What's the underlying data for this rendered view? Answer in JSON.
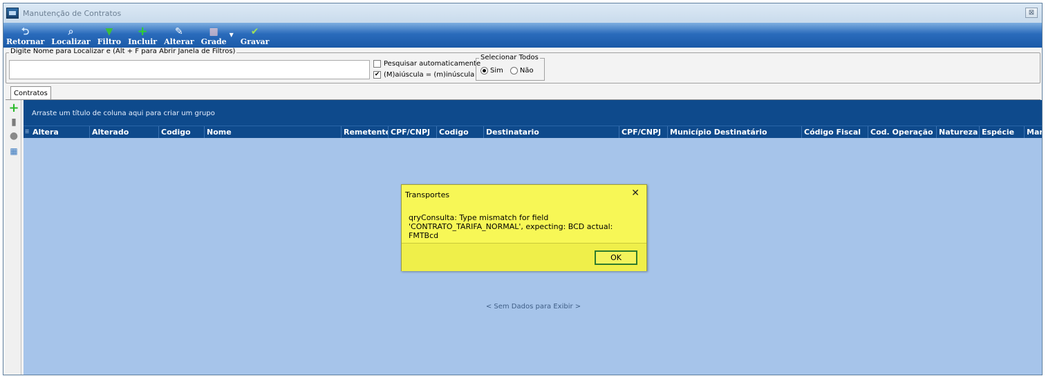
{
  "window": {
    "title": "Manutenção de Contratos",
    "close_glyph": "⊠"
  },
  "toolbar": {
    "buttons": [
      {
        "label": "Retornar",
        "icon": "undo-icon",
        "glyph": "⮌"
      },
      {
        "label": "Localizar",
        "icon": "search-icon",
        "glyph": "⌕"
      },
      {
        "label": "Filtro",
        "icon": "filter-icon",
        "glyph": "▼"
      },
      {
        "label": "Incluir",
        "icon": "plus-icon",
        "glyph": "+"
      },
      {
        "label": "Alterar",
        "icon": "edit-icon",
        "glyph": "✎"
      },
      {
        "label": "Grade",
        "icon": "grid-icon",
        "glyph": "▦"
      },
      {
        "label": "Gravar",
        "icon": "check-icon",
        "glyph": "✔"
      }
    ],
    "dropdown_glyph": "▼"
  },
  "search": {
    "legend": "Digite Nome para Localizar e (Alt + F para Abrir Janela de Filtros)",
    "value": "",
    "auto_search": {
      "label": "Pesquisar automaticamente",
      "checked_glyph": ""
    },
    "case_insensitive": {
      "label": "(M)aiúscula = (m)inúscula",
      "checked_glyph": "✔"
    },
    "select_all": {
      "legend": "Selecionar Todos",
      "yes": "Sim",
      "no": "Não"
    }
  },
  "tabs": [
    {
      "label": "Contratos"
    }
  ],
  "side_tools": {
    "add": "+",
    "delete": "▮",
    "info": "●",
    "grid": "▦"
  },
  "grid": {
    "group_panel_text": "Arraste um título de coluna aqui para criar um grupo",
    "indicator": "☰",
    "columns": [
      "Altera",
      "Alterado",
      "Codigo",
      "Nome",
      "Remetente",
      "CPF/CNPJ",
      "Codigo",
      "Destinatario",
      "CPF/CNPJ",
      "Município Destinatário",
      "Código Fiscal",
      "Cod. Operação",
      "Natureza",
      "Espécie",
      "Mar"
    ],
    "empty_text": "< Sem Dados para Exibir >"
  },
  "dialog": {
    "title": "Transportes",
    "close_glyph": "✕",
    "message_line1": "qryConsulta: Type mismatch for field",
    "message_line2": "'CONTRATO_TARIFA_NORMAL', expecting: BCD actual: FMTBcd",
    "ok_label": "OK"
  },
  "colors": {
    "toolbar_blue": "#2a6bbb",
    "grid_header": "#0e4a8c",
    "grid_body": "#a6c4ea",
    "dialog_bg": "#f7f756",
    "ok_border": "#2d7a2d"
  }
}
